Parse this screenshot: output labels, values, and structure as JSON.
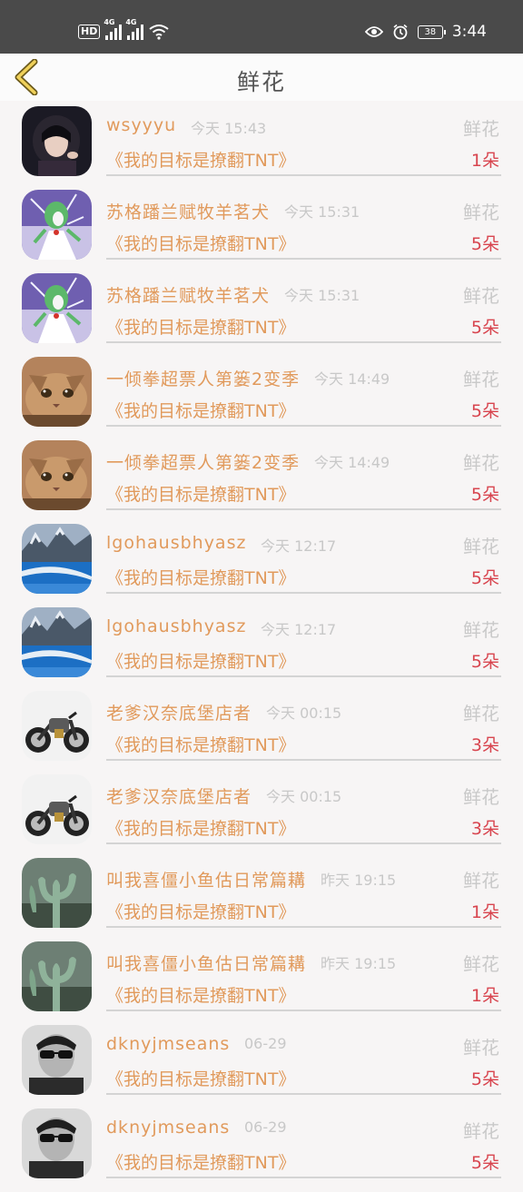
{
  "status_bar": {
    "hd": "HD",
    "sim1": "4G",
    "sim2": "4G",
    "battery": "38",
    "time": "3:44"
  },
  "header": {
    "title": "鲜花"
  },
  "colors": {
    "name": "#e19a5c",
    "count": "#d8454f",
    "muted": "#c8c8c8",
    "statusbar": "#4a4a4a"
  },
  "items": [
    {
      "name": "wsyyyu",
      "time": "今天 15:43",
      "kind": "鲜花",
      "book": "《我的目标是撩翻TNT》",
      "count": "1朵",
      "avatar": "girl"
    },
    {
      "name": "苏格蹯兰赋牧羊茗犬",
      "time": "今天 15:31",
      "kind": "鲜花",
      "book": "《我的目标是撩翻TNT》",
      "count": "5朵",
      "avatar": "gardevoir"
    },
    {
      "name": "苏格蹯兰赋牧羊茗犬",
      "time": "今天 15:31",
      "kind": "鲜花",
      "book": "《我的目标是撩翻TNT》",
      "count": "5朵",
      "avatar": "gardevoir"
    },
    {
      "name": "一倾拳超票人第篓2变季",
      "time": "今天 14:49",
      "kind": "鲜花",
      "book": "《我的目标是撩翻TNT》",
      "count": "5朵",
      "avatar": "cat"
    },
    {
      "name": "一倾拳超票人第篓2变季",
      "time": "今天 14:49",
      "kind": "鲜花",
      "book": "《我的目标是撩翻TNT》",
      "count": "5朵",
      "avatar": "cat"
    },
    {
      "name": "lgohausbhyasz",
      "time": "今天 12:17",
      "kind": "鲜花",
      "book": "《我的目标是撩翻TNT》",
      "count": "5朵",
      "avatar": "lake"
    },
    {
      "name": "lgohausbhyasz",
      "time": "今天 12:17",
      "kind": "鲜花",
      "book": "《我的目标是撩翻TNT》",
      "count": "5朵",
      "avatar": "lake"
    },
    {
      "name": "老爹汉奈底堡店者",
      "time": "今天 00:15",
      "kind": "鲜花",
      "book": "《我的目标是撩翻TNT》",
      "count": "3朵",
      "avatar": "moto"
    },
    {
      "name": "老爹汉奈底堡店者",
      "time": "今天 00:15",
      "kind": "鲜花",
      "book": "《我的目标是撩翻TNT》",
      "count": "3朵",
      "avatar": "moto"
    },
    {
      "name": "叫我喜僵小鱼估日常篇耩",
      "time": "昨天 19:15",
      "kind": "鲜花",
      "book": "《我的目标是撩翻TNT》",
      "count": "1朵",
      "avatar": "cactus"
    },
    {
      "name": "叫我喜僵小鱼估日常篇耩",
      "time": "昨天 19:15",
      "kind": "鲜花",
      "book": "《我的目标是撩翻TNT》",
      "count": "1朵",
      "avatar": "cactus"
    },
    {
      "name": "dknyjmseans",
      "time": "06-29",
      "kind": "鲜花",
      "book": "《我的目标是撩翻TNT》",
      "count": "5朵",
      "avatar": "man"
    },
    {
      "name": "dknyjmseans",
      "time": "06-29",
      "kind": "鲜花",
      "book": "《我的目标是撩翻TNT》",
      "count": "5朵",
      "avatar": "man"
    }
  ]
}
